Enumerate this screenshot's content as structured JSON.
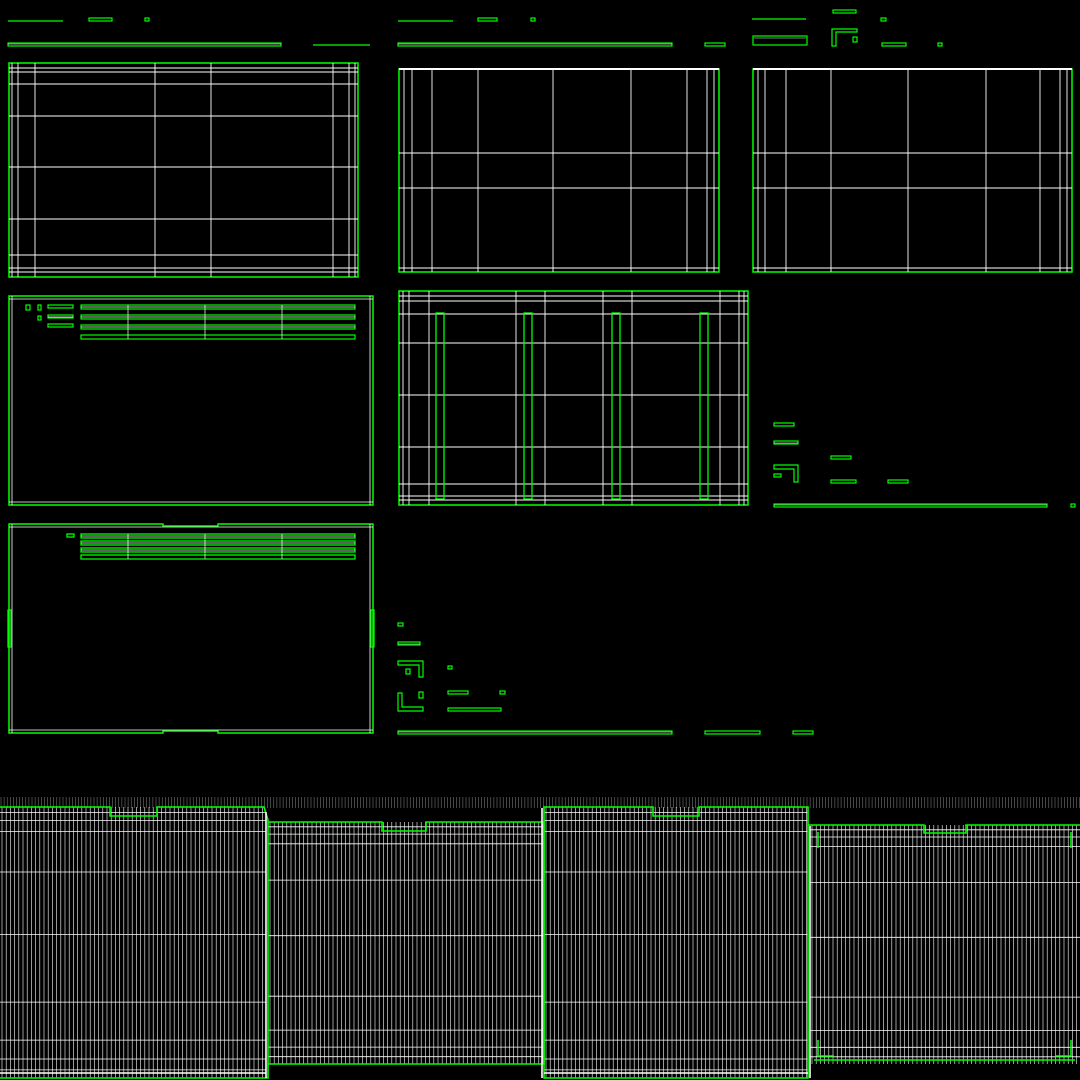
{
  "colors": {
    "background": "#000000",
    "uv_edge": "#ffffff",
    "seam_edge": "#00ff00"
  }
}
